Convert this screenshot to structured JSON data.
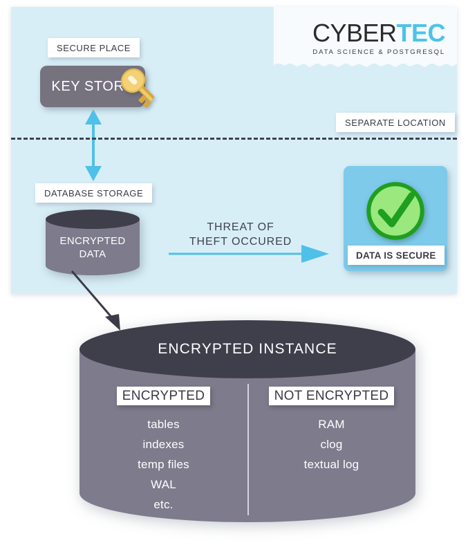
{
  "logo": {
    "part1": "CYBER",
    "part2": "TEC",
    "tagline": "DATA SCIENCE & POSTGRESQL",
    "accent_color": "#4ec3e8",
    "dark_color": "#2b2b2b"
  },
  "panel": {
    "background_color": "#d8eef7",
    "labels": {
      "secure_place": "SECURE PLACE",
      "separate_location": "SEPARATE LOCATION",
      "database_storage": "DATABASE STORAGE",
      "data_is_secure": "DATA IS SECURE"
    },
    "key_store": {
      "label": "KEY STORE",
      "box_color": "#76737f",
      "icon": "key-icon"
    },
    "small_cylinder": {
      "line1": "ENCRYPTED",
      "line2": "DATA",
      "top_color": "#3f3e4b",
      "body_color": "#7d7b8c"
    },
    "threat": {
      "line1": "THREAT OF",
      "line2": "THEFT OCCURED",
      "arrow_color": "#4fc0e8",
      "arrow_name": "threat-arrow"
    },
    "secure_panel": {
      "background_color": "#7ecaea",
      "icon": "green-check-icon",
      "check_fill": "#90e878",
      "check_stroke": "#1f9e1f"
    },
    "divider": {
      "name": "dashed-separator",
      "color": "#3c4250",
      "style": "dashed"
    },
    "vertical_arrow": {
      "name": "key-sync-double-arrow",
      "color": "#4fc0e8",
      "direction": "both"
    }
  },
  "diagram": {
    "diagonal_arrow": {
      "name": "instance-pointer-arrow",
      "color": "#3c3c48"
    },
    "instance": {
      "title": "ENCRYPTED INSTANCE",
      "top_color": "#3f3e4b",
      "body_color": "#7d7b8c",
      "columns": [
        {
          "header": "ENCRYPTED",
          "items": [
            "tables",
            "indexes",
            "temp files",
            "WAL",
            "etc."
          ]
        },
        {
          "header": "NOT ENCRYPTED",
          "items": [
            "RAM",
            "clog",
            "textual log"
          ]
        }
      ]
    }
  }
}
